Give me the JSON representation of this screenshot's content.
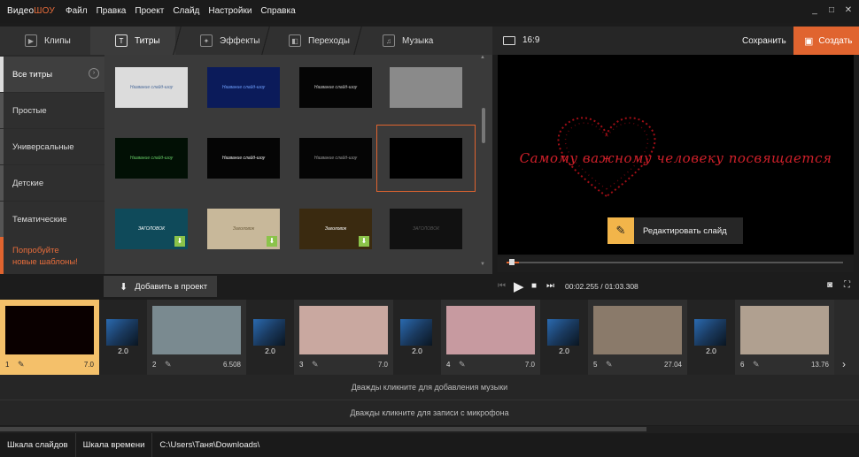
{
  "app": {
    "logo_prefix": "Видео",
    "logo_suffix": "ШОУ"
  },
  "menu": [
    "Файл",
    "Правка",
    "Проект",
    "Слайд",
    "Настройки",
    "Справка"
  ],
  "window": {
    "minimize": "_",
    "maximize": "□",
    "close": "✕"
  },
  "tabs": [
    {
      "label": "Клипы",
      "icon": "clip-icon"
    },
    {
      "label": "Титры",
      "icon": "titles-icon",
      "active": true
    },
    {
      "label": "Эффекты",
      "icon": "effects-icon"
    },
    {
      "label": "Переходы",
      "icon": "transitions-icon"
    },
    {
      "label": "Музыка",
      "icon": "music-icon"
    }
  ],
  "header": {
    "ratio": "16:9",
    "save": "Сохранить",
    "create": "Создать"
  },
  "categories": [
    {
      "label": "Все титры",
      "active": true
    },
    {
      "label": "Простые"
    },
    {
      "label": "Универсальные"
    },
    {
      "label": "Детские"
    },
    {
      "label": "Тематические"
    }
  ],
  "promo": {
    "line1": "Попробуйте",
    "line2": "новые шаблоны!"
  },
  "thumbnails": [
    {
      "bg": "#dcdcdc",
      "text": "Название слайд-шоу",
      "color": "#4a6a9a"
    },
    {
      "bg": "#0b1b5a",
      "text": "Название слайд-шоу",
      "color": "#6fa0ff"
    },
    {
      "bg": "#050505",
      "text": "Название слайд-шоу",
      "color": "#ccc"
    },
    {
      "bg": "#8a8a8a",
      "text": "",
      "color": "#fff"
    },
    {
      "bg": "#021005",
      "text": "Название слайд-шоу",
      "color": "#6c6"
    },
    {
      "bg": "#050505",
      "text": "Название слайд-шоу",
      "color": "#eee"
    },
    {
      "bg": "#050505",
      "text": "Название слайд-шоу",
      "color": "#999"
    },
    {
      "bg": "#000",
      "text": "",
      "color": "#c22"
    },
    {
      "bg": "#0f4a5a",
      "text": "ЗАГОЛОВОК",
      "color": "#fff",
      "download": true
    },
    {
      "bg": "#c8b89a",
      "text": "Заголовок",
      "color": "#6a5a3a",
      "download": true
    },
    {
      "bg": "#3a2a10",
      "text": "Заголовок",
      "color": "#fff",
      "download": true
    },
    {
      "bg": "#111",
      "text": "ЗАГОЛОВОК",
      "color": "#555"
    }
  ],
  "preview": {
    "title_text": "Самому важному человеку посвящается",
    "edit_button": "Редактировать слайд",
    "accent": "#d0202a"
  },
  "player": {
    "current": "00:02.255",
    "total": "01:03.308",
    "separator": "/"
  },
  "add_button": "Добавить в проект",
  "slides": [
    {
      "num": "1",
      "dur": "7.0",
      "active": true
    },
    {
      "num": "2",
      "dur": "6.508"
    },
    {
      "num": "3",
      "dur": "7.0"
    },
    {
      "num": "4",
      "dur": "7.0"
    },
    {
      "num": "5",
      "dur": "27.04"
    },
    {
      "num": "6",
      "dur": "13.76"
    }
  ],
  "transitions": [
    "2.0",
    "2.0",
    "2.0",
    "2.0",
    "2.0"
  ],
  "tracks": {
    "music": "Дважды кликните для добавления музыки",
    "mic": "Дважды кликните для записи с микрофона"
  },
  "status": {
    "slides": "Шкала слайдов",
    "timeline": "Шкала времени",
    "path": "C:\\Users\\Таня\\Downloads\\"
  }
}
